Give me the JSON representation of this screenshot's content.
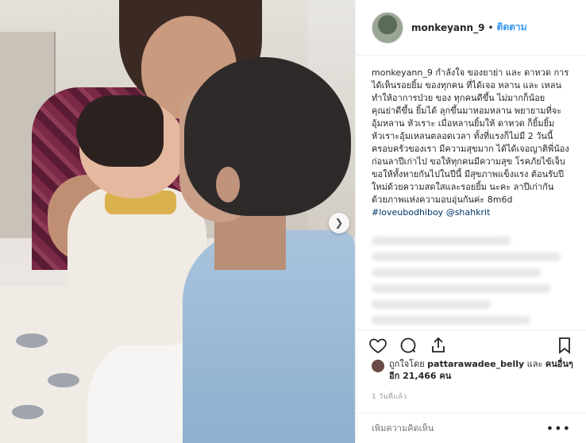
{
  "post": {
    "username": "monkeyann_9",
    "separator": "•",
    "follow_label": "ติดตาม"
  },
  "caption": {
    "username": "monkeyann_9",
    "text": "กำลังใจ ของยาย่า และ ดาหวด การได้เห็นรอยยิ้ม ของทุกคน ที่ได้เจอ หลาน และ เหลน ทำให้อาการป่วย ของ ทุกคนดีขึ้น ไม่มากก็น้อย คุณย่าดีขึ้น ยิ้มได้ ลุกขึ้นมาหอมหลาน พยายามที่จะอุ้มหลาน หัวเราะ เมื่อหลานยิ้มให้ ดาหวด ก็ยิ้มยิ้ม หัวเราะอุ้มเหลนตลอดเวลา ทั้งที่แรงก็ไม่มี 2 วันนี้ ครอบครัวของเรา มีความสุขมาก ได้ได้เจอญาติพี่น้อง ก่อนลาปีเก่าไป ขอให้ทุกคนมีความสุข โรคภัยไข้เจ็บ ขอให้ทั้งหายกันไปในปีนี้ มีสุขภาพแข็งแรง ต้อนรับปีใหม่ด้วยความสดใสและรอยยิ้ม นะคะ ลาปีเก่ากัน ด้วยภาพแห่งความอบอุ่นกันค่ะ 8m6d",
    "hashtag": "#loveubodhiboy",
    "mention": "@shahkrit"
  },
  "likes": {
    "prefix": "ถูกใจโดย",
    "first_user": "pattarawadee_belly",
    "connector": "และ",
    "others": "คนอื่นๆ อีก 21,466 คน"
  },
  "time": "1 วันที่แล้ว",
  "comment_box": {
    "placeholder": "เพิ่มความคิดเห็น",
    "more_label": "•••"
  },
  "icons": {
    "like": "heart-icon",
    "comment": "comment-icon",
    "share": "share-icon",
    "save": "bookmark-icon",
    "next": "chevron-right-icon"
  },
  "colors": {
    "follow": "#3897f0",
    "text": "#262626",
    "muted": "#999999"
  }
}
